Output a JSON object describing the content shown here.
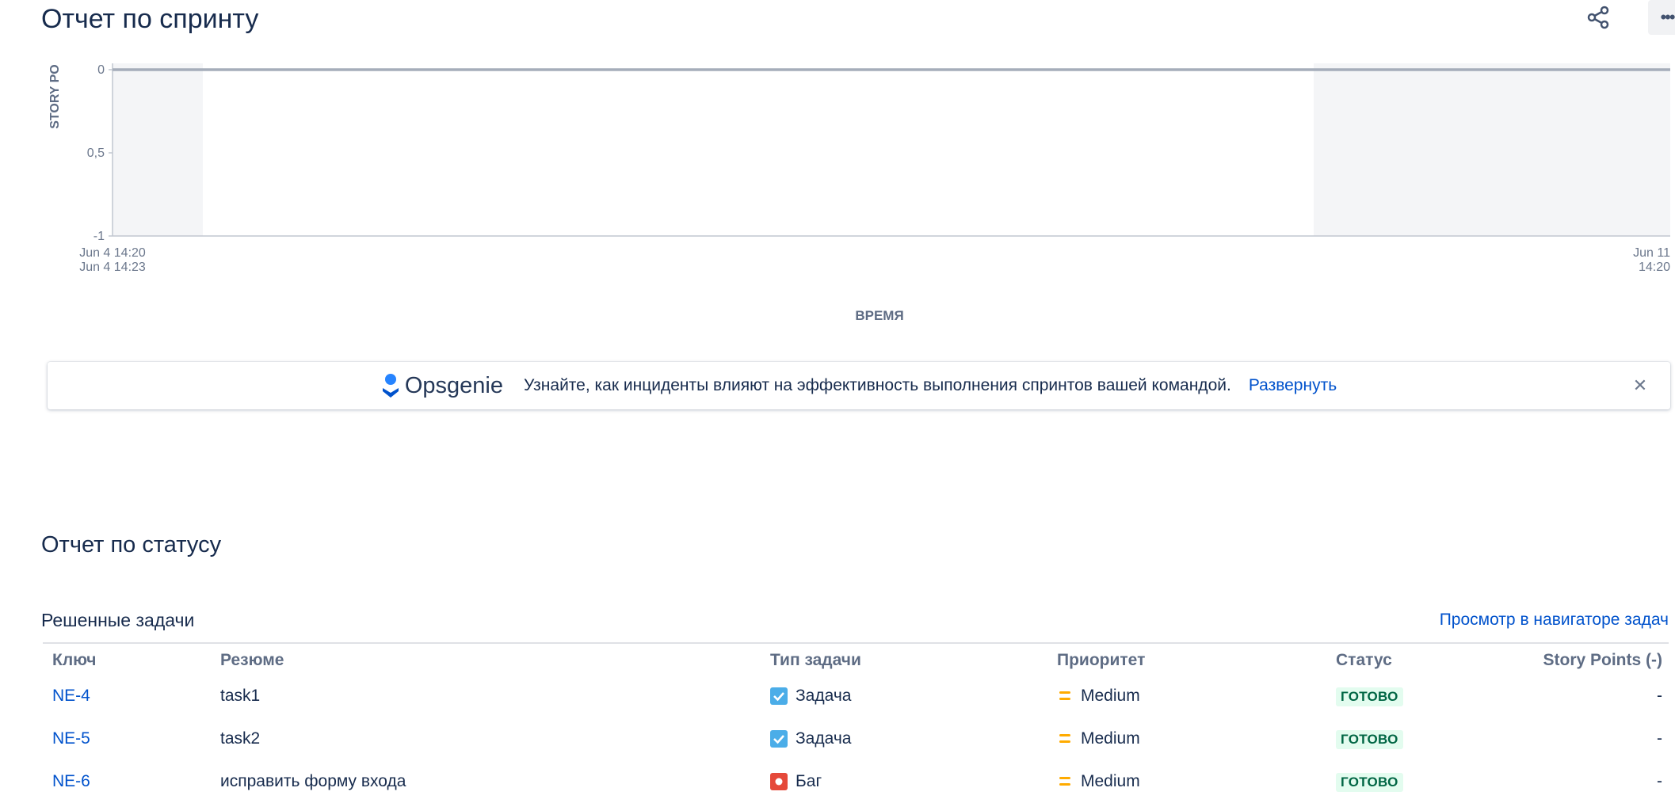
{
  "page": {
    "title": "Отчет по спринту"
  },
  "toolbar": {
    "share_icon": "share-icon",
    "more_icon": "more-icon",
    "more_label": "•••"
  },
  "chart_data": {
    "type": "line",
    "xlabel": "ВРЕМЯ",
    "ylabel": "STORY PO",
    "y_ticks": [
      "0",
      "0,5",
      "-1"
    ],
    "x_tick_labels": {
      "start_line1": "Jun 4 14:20",
      "start_line2": "Jun 4 14:23",
      "end_line1": "Jun 11",
      "end_line2": "14:20"
    },
    "ylim": [
      -1,
      0
    ],
    "series": [
      {
        "x": [
          "Jun 4 14:20",
          "Jun 11 14:20"
        ],
        "values": [
          0,
          0
        ]
      }
    ],
    "non_working_color": "#f4f5f7",
    "line_color": "#a5adba"
  },
  "banner": {
    "brand": "Opsgenie",
    "message": "Узнайте, как инциденты влияют на эффективность выполнения спринтов вашей командой.",
    "link": "Развернуть",
    "close_label": "✕"
  },
  "status_report": {
    "title": "Отчет по статусу",
    "resolved_title": "Решенные задачи",
    "navigator_link": "Просмотр в навигаторе задач",
    "columns": [
      "Ключ",
      "Резюме",
      "Тип задачи",
      "Приоритет",
      "Статус",
      "Story Points (-)"
    ],
    "rows": [
      {
        "key": "NE-4",
        "summary": "task1",
        "type": "Задача",
        "type_icon": "task-icon",
        "priority": "Medium",
        "status": "ГОТОВО",
        "sp": "-"
      },
      {
        "key": "NE-5",
        "summary": "task2",
        "type": "Задача",
        "type_icon": "task-icon",
        "priority": "Medium",
        "status": "ГОТОВО",
        "sp": "-"
      },
      {
        "key": "NE-6",
        "summary": "исправить форму входа",
        "type": "Баг",
        "type_icon": "bug-icon",
        "priority": "Medium",
        "status": "ГОТОВО",
        "sp": "-"
      }
    ]
  },
  "colors": {
    "link": "#0052cc",
    "task_icon": "#4bade8",
    "bug_icon": "#e5493a",
    "priority_medium": "#ffab00",
    "status_done_bg": "#e3fcef",
    "status_done_text": "#006644"
  }
}
